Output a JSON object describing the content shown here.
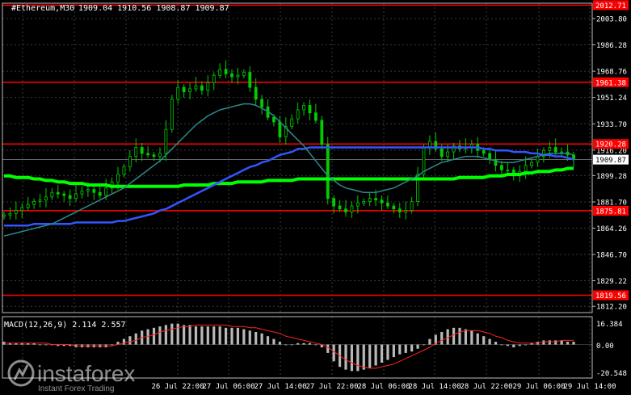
{
  "header": {
    "symbol_label": "#Ethereum,M30",
    "ohlc": "1909.04 1910.56 1908.87 1909.87"
  },
  "macd": {
    "label": "MACD(12,26,9) 2.114 2.557",
    "ticks": [
      "16.384",
      "0.00",
      "-20.548"
    ]
  },
  "watermark": {
    "brand": "instaforex",
    "tagline": "Instant Forex Trading"
  },
  "colors": {
    "background": "#000000",
    "candles": "#00cc00",
    "grid": "#3a3a3a",
    "level_lines": "#ff0000",
    "ma_fast": "#2a8a8a",
    "ma_mid": "#3355ff",
    "ma_slow": "#00ff00",
    "macd_hist": "#b8b8b8",
    "macd_signal": "#ff2222",
    "axis_text": "#ffffff"
  },
  "chart_data": {
    "type": "candlestick",
    "symbol": "#Ethereum",
    "timeframe": "M30",
    "current_price": 1909.87,
    "x_ticks": [
      "26 Jul 22:00",
      "27 Jul 06:00",
      "27 Jul 14:00",
      "27 Jul 22:00",
      "28 Jul 06:00",
      "28 Jul 14:00",
      "28 Jul 22:00",
      "29 Jul 06:00",
      "29 Jul 14:00"
    ],
    "y_ticks": [
      2003.8,
      1986.28,
      1968.76,
      1951.24,
      1933.7,
      1916.2,
      1899.28,
      1881.7,
      1864.26,
      1846.7,
      1829.22,
      1812.2
    ],
    "y_range": [
      1808.0,
      2014.0
    ],
    "levels": [
      2012.71,
      1961.38,
      1920.28,
      1875.81,
      1819.56
    ],
    "close": [
      1873,
      1874,
      1876,
      1878,
      1880,
      1882,
      1883,
      1885,
      1888,
      1887,
      1886,
      1884,
      1887,
      1889,
      1890,
      1888,
      1886,
      1891,
      1895,
      1900,
      1905,
      1912,
      1918,
      1914,
      1913,
      1912,
      1914,
      1930,
      1950,
      1958,
      1955,
      1957,
      1959,
      1956,
      1961,
      1966,
      1970,
      1967,
      1965,
      1966,
      1968,
      1958,
      1950,
      1945,
      1938,
      1935,
      1925,
      1932,
      1937,
      1943,
      1946,
      1941,
      1936,
      1920,
      1884,
      1879,
      1877,
      1875,
      1879,
      1881,
      1882,
      1884,
      1883,
      1881,
      1879,
      1877,
      1875,
      1876,
      1882,
      1900,
      1918,
      1922,
      1917,
      1912,
      1915,
      1919,
      1917,
      1918,
      1920,
      1916,
      1914,
      1910,
      1906,
      1903,
      1903,
      1899,
      1902,
      1906,
      1908,
      1912,
      1916,
      1918,
      1915,
      1915,
      1913,
      1909.87
    ],
    "ma_fast": [
      1859,
      1860,
      1861,
      1862,
      1863,
      1864,
      1865,
      1866,
      1867,
      1869,
      1871,
      1873,
      1875,
      1877,
      1879,
      1881,
      1883,
      1885,
      1887,
      1889,
      1891,
      1894,
      1897,
      1900,
      1903,
      1906,
      1909,
      1913,
      1917,
      1921,
      1925,
      1929,
      1933,
      1936,
      1939,
      1941,
      1943,
      1944,
      1945,
      1946,
      1947,
      1947,
      1946,
      1944,
      1942,
      1939,
      1935,
      1931,
      1927,
      1923,
      1919,
      1914,
      1909,
      1904,
      1899,
      1896,
      1893,
      1891,
      1890,
      1889,
      1888,
      1888,
      1888,
      1889,
      1890,
      1891,
      1893,
      1895,
      1897,
      1899,
      1902,
      1904,
      1906,
      1908,
      1909,
      1910,
      1911,
      1912,
      1912,
      1912,
      1911,
      1910,
      1909,
      1908,
      1908,
      1908,
      1909,
      1910,
      1911,
      1912,
      1913,
      1914,
      1914,
      1914,
      1914,
      1913
    ],
    "ma_mid": [
      1866,
      1866,
      1866,
      1866,
      1866,
      1867,
      1867,
      1867,
      1867,
      1867,
      1867,
      1867,
      1868,
      1868,
      1868,
      1868,
      1868,
      1868,
      1868,
      1869,
      1869,
      1870,
      1871,
      1872,
      1873,
      1874,
      1876,
      1877,
      1879,
      1881,
      1883,
      1885,
      1887,
      1889,
      1891,
      1893,
      1895,
      1897,
      1899,
      1901,
      1903,
      1905,
      1906,
      1908,
      1909,
      1911,
      1913,
      1914,
      1915,
      1917,
      1917,
      1918,
      1918,
      1918,
      1918,
      1918,
      1918,
      1918,
      1918,
      1918,
      1918,
      1918,
      1918,
      1918,
      1918,
      1918,
      1918,
      1918,
      1918,
      1918,
      1918,
      1918,
      1918,
      1918,
      1918,
      1918,
      1918,
      1918,
      1918,
      1918,
      1917,
      1917,
      1916,
      1916,
      1916,
      1915,
      1915,
      1915,
      1914,
      1914,
      1913,
      1913,
      1912,
      1912,
      1911,
      1910
    ],
    "ma_slow": [
      1899,
      1899,
      1898,
      1898,
      1898,
      1897,
      1897,
      1896,
      1896,
      1895,
      1895,
      1894,
      1894,
      1894,
      1893,
      1893,
      1893,
      1893,
      1892,
      1892,
      1892,
      1892,
      1892,
      1892,
      1892,
      1892,
      1892,
      1892,
      1892,
      1892,
      1893,
      1893,
      1893,
      1893,
      1893,
      1894,
      1894,
      1894,
      1894,
      1895,
      1895,
      1895,
      1895,
      1895,
      1896,
      1896,
      1896,
      1896,
      1896,
      1897,
      1897,
      1897,
      1897,
      1897,
      1897,
      1897,
      1897,
      1897,
      1897,
      1897,
      1897,
      1897,
      1897,
      1897,
      1897,
      1897,
      1897,
      1897,
      1897,
      1897,
      1897,
      1897,
      1897,
      1897,
      1897,
      1897,
      1898,
      1898,
      1898,
      1898,
      1898,
      1899,
      1899,
      1899,
      1900,
      1900,
      1900,
      1901,
      1901,
      1902,
      1902,
      1902,
      1903,
      1903,
      1904,
      1904
    ],
    "macd_range": [
      -24,
      20
    ],
    "macd_hist": [
      2,
      1,
      1,
      1,
      1,
      1,
      0,
      0,
      0,
      -1,
      -1,
      -1,
      -2,
      -2,
      -2,
      -2,
      -2,
      -2,
      0,
      2,
      4,
      6,
      8,
      10,
      11,
      12,
      13,
      14,
      15,
      15,
      14,
      14,
      13,
      13,
      13,
      13,
      13,
      12,
      12,
      12,
      11,
      10,
      9,
      8,
      6,
      4,
      2,
      0,
      0,
      1,
      1,
      1,
      0,
      -2,
      -6,
      -12,
      -16,
      -18,
      -19,
      -19,
      -18,
      -17,
      -15,
      -13,
      -11,
      -9,
      -7,
      -6,
      -5,
      -3,
      0,
      4,
      7,
      9,
      11,
      12,
      12,
      11,
      10,
      8,
      6,
      4,
      2,
      0,
      -1,
      -2,
      -1,
      0,
      1,
      2,
      3,
      3,
      3,
      3,
      2,
      2
    ],
    "macd_signal": [
      1,
      1,
      1,
      1,
      1,
      1,
      1,
      1,
      0,
      0,
      0,
      0,
      -1,
      -1,
      -1,
      -1,
      -1,
      -1,
      -1,
      0,
      1,
      2,
      3,
      5,
      6,
      7,
      9,
      10,
      11,
      12,
      13,
      13,
      14,
      14,
      14,
      14,
      14,
      14,
      13,
      13,
      13,
      12,
      12,
      11,
      10,
      9,
      8,
      6,
      5,
      4,
      3,
      2,
      1,
      0,
      -2,
      -5,
      -8,
      -11,
      -13,
      -15,
      -16,
      -17,
      -17,
      -16,
      -15,
      -14,
      -12,
      -10,
      -8,
      -6,
      -4,
      -2,
      1,
      3,
      5,
      7,
      9,
      10,
      10,
      10,
      9,
      8,
      6,
      5,
      3,
      2,
      1,
      1,
      1,
      1,
      2,
      2,
      2,
      3,
      3,
      3
    ]
  }
}
